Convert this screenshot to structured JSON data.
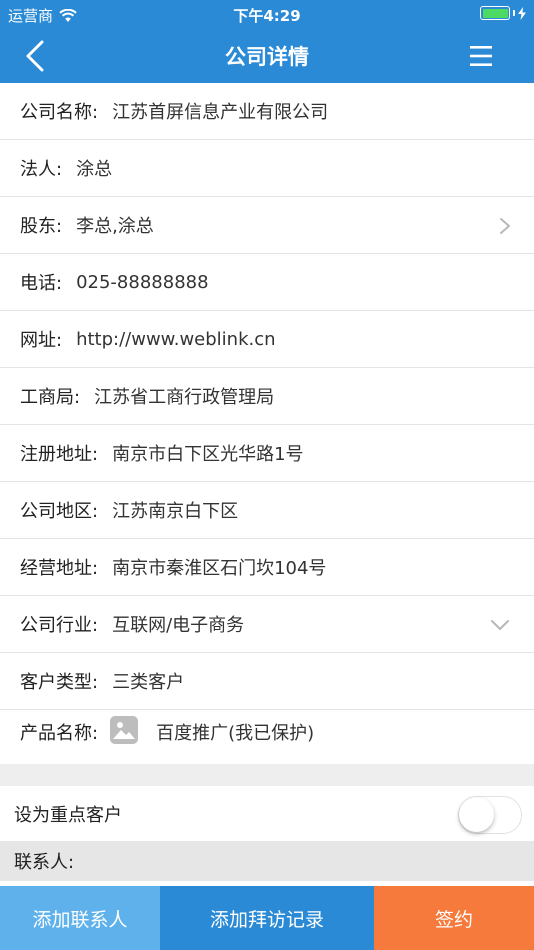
{
  "status_bar": {
    "carrier": "运营商",
    "time": "下午4:29"
  },
  "nav": {
    "title": "公司详情",
    "back_icon": "chevron-left-icon",
    "menu_icon": "hamburger-menu-icon"
  },
  "info": {
    "company_name": {
      "label": "公司名称:",
      "value": "江苏首屏信息产业有限公司"
    },
    "legal_person": {
      "label": "法人:",
      "value": "涂总"
    },
    "shareholders": {
      "label": "股东:",
      "value": "李总,涂总"
    },
    "phone": {
      "label": "电话:",
      "value": "025-88888888"
    },
    "website": {
      "label": "网址:",
      "value": "http://www.weblink.cn"
    },
    "bureau": {
      "label": "工商局:",
      "value": "江苏省工商行政管理局"
    },
    "registered_address": {
      "label": "注册地址:",
      "value": "南京市白下区光华路1号"
    },
    "region": {
      "label": "公司地区:",
      "value": "江苏南京白下区"
    },
    "business_address": {
      "label": "经营地址:",
      "value": "南京市秦淮区石门坎104号"
    },
    "industry": {
      "label": "公司行业:",
      "value": "互联网/电子商务"
    },
    "customer_type": {
      "label": "客户类型:",
      "value": "三类客户"
    },
    "product": {
      "label": "产品名称:",
      "value": "百度推广(我已保护)"
    }
  },
  "key_customer": {
    "label": "设为重点客户",
    "enabled": false
  },
  "contacts": {
    "label": "联系人:"
  },
  "actions": {
    "add_contact": "添加联系人",
    "add_visit": "添加拜访记录",
    "sign": "签约"
  },
  "colors": {
    "primary": "#2a8ad6",
    "light_blue": "#5fb1ec",
    "orange": "#f67a3c"
  }
}
